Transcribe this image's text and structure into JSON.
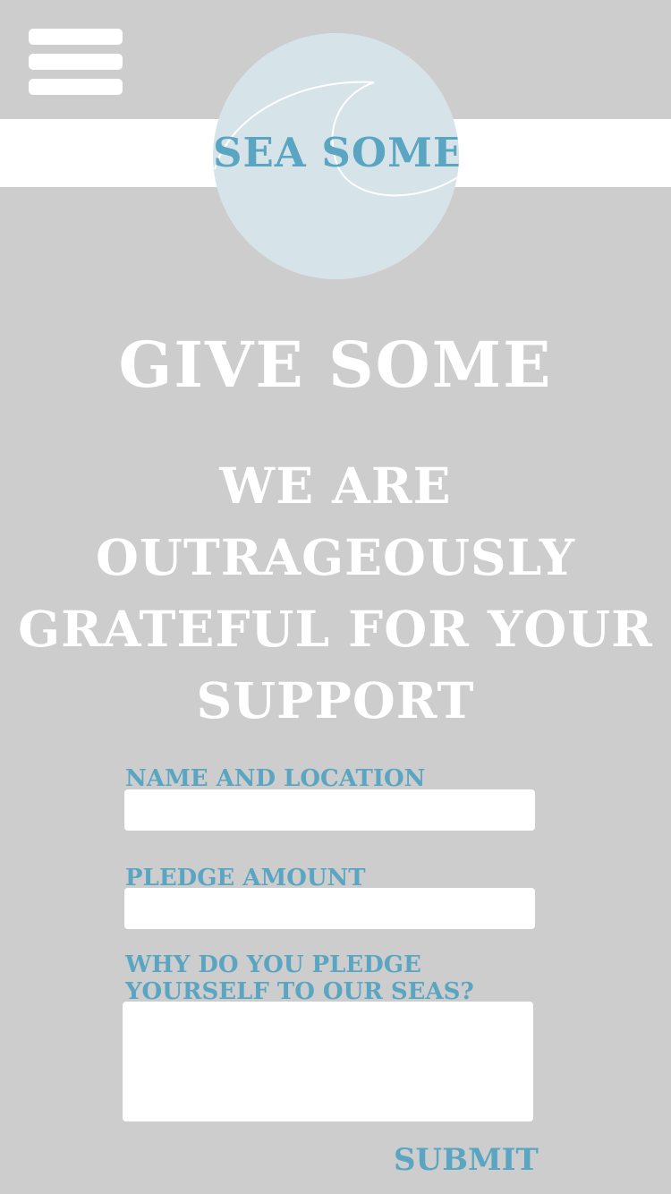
{
  "header": {
    "menu_icon": "hamburger-menu-icon",
    "logo_text": "SEA SOME",
    "colors": {
      "background": "#cdcdcd",
      "banner": "#ffffff",
      "logo_circle": "#d6e4ea",
      "accent": "#5aa6c2"
    }
  },
  "main": {
    "title": "GIVE SOME",
    "subtitle": "WE ARE OUTRAGEOUSLY GRATEFUL FOR YOUR SUPPORT"
  },
  "form": {
    "name_label": "NAME AND LOCATION",
    "name_value": "",
    "pledge_label": "PLEDGE AMOUNT",
    "pledge_value": "",
    "why_label": "WHY DO YOU PLEDGE YOURSELF TO OUR SEAS?",
    "why_value": "",
    "submit_label": "SUBMIT"
  }
}
